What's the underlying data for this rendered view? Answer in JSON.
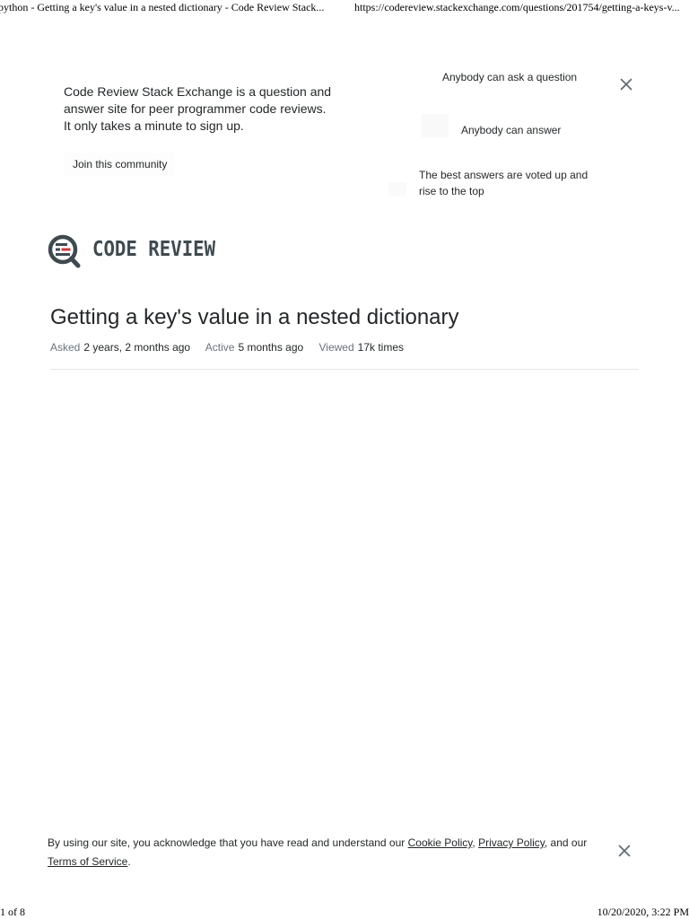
{
  "print_header": {
    "page_title": "python - Getting a key's value in a nested dictionary - Code Review Stack...",
    "url": "https://codereview.stackexchange.com/questions/201754/getting-a-keys-v..."
  },
  "banner": {
    "description": "Code Review Stack Exchange is a question and answer site for peer programmer code reviews. It only takes a minute to sign up.",
    "join_label": "Join this community",
    "features": [
      "Anybody can ask a question",
      "Anybody can answer",
      "The best answers are voted up and rise to the top"
    ],
    "close_icon": "close-icon"
  },
  "logo": {
    "text": "CODE REVIEW",
    "accent_color": "#d1383d",
    "icon_color": "#3f4a50"
  },
  "question": {
    "title": "Getting a key's value in a nested dictionary",
    "asked_label": "Asked",
    "asked_value": "2 years, 2 months ago",
    "active_label": "Active",
    "active_value": "5 months ago",
    "viewed_label": "Viewed",
    "viewed_value": "17k times"
  },
  "cookie_notice": {
    "text_before": "By using our site, you acknowledge that you have read and understand our ",
    "cookie_policy_link": "Cookie Policy",
    "sep1": ", ",
    "privacy_policy_link": "Privacy Policy",
    "text_mid": ", and our ",
    "terms_link": "Terms of Service",
    "text_end": ".",
    "close_icon": "close-icon"
  },
  "print_footer": {
    "page_number": "1 of 8",
    "datetime": "10/20/2020, 3:22 PM"
  }
}
